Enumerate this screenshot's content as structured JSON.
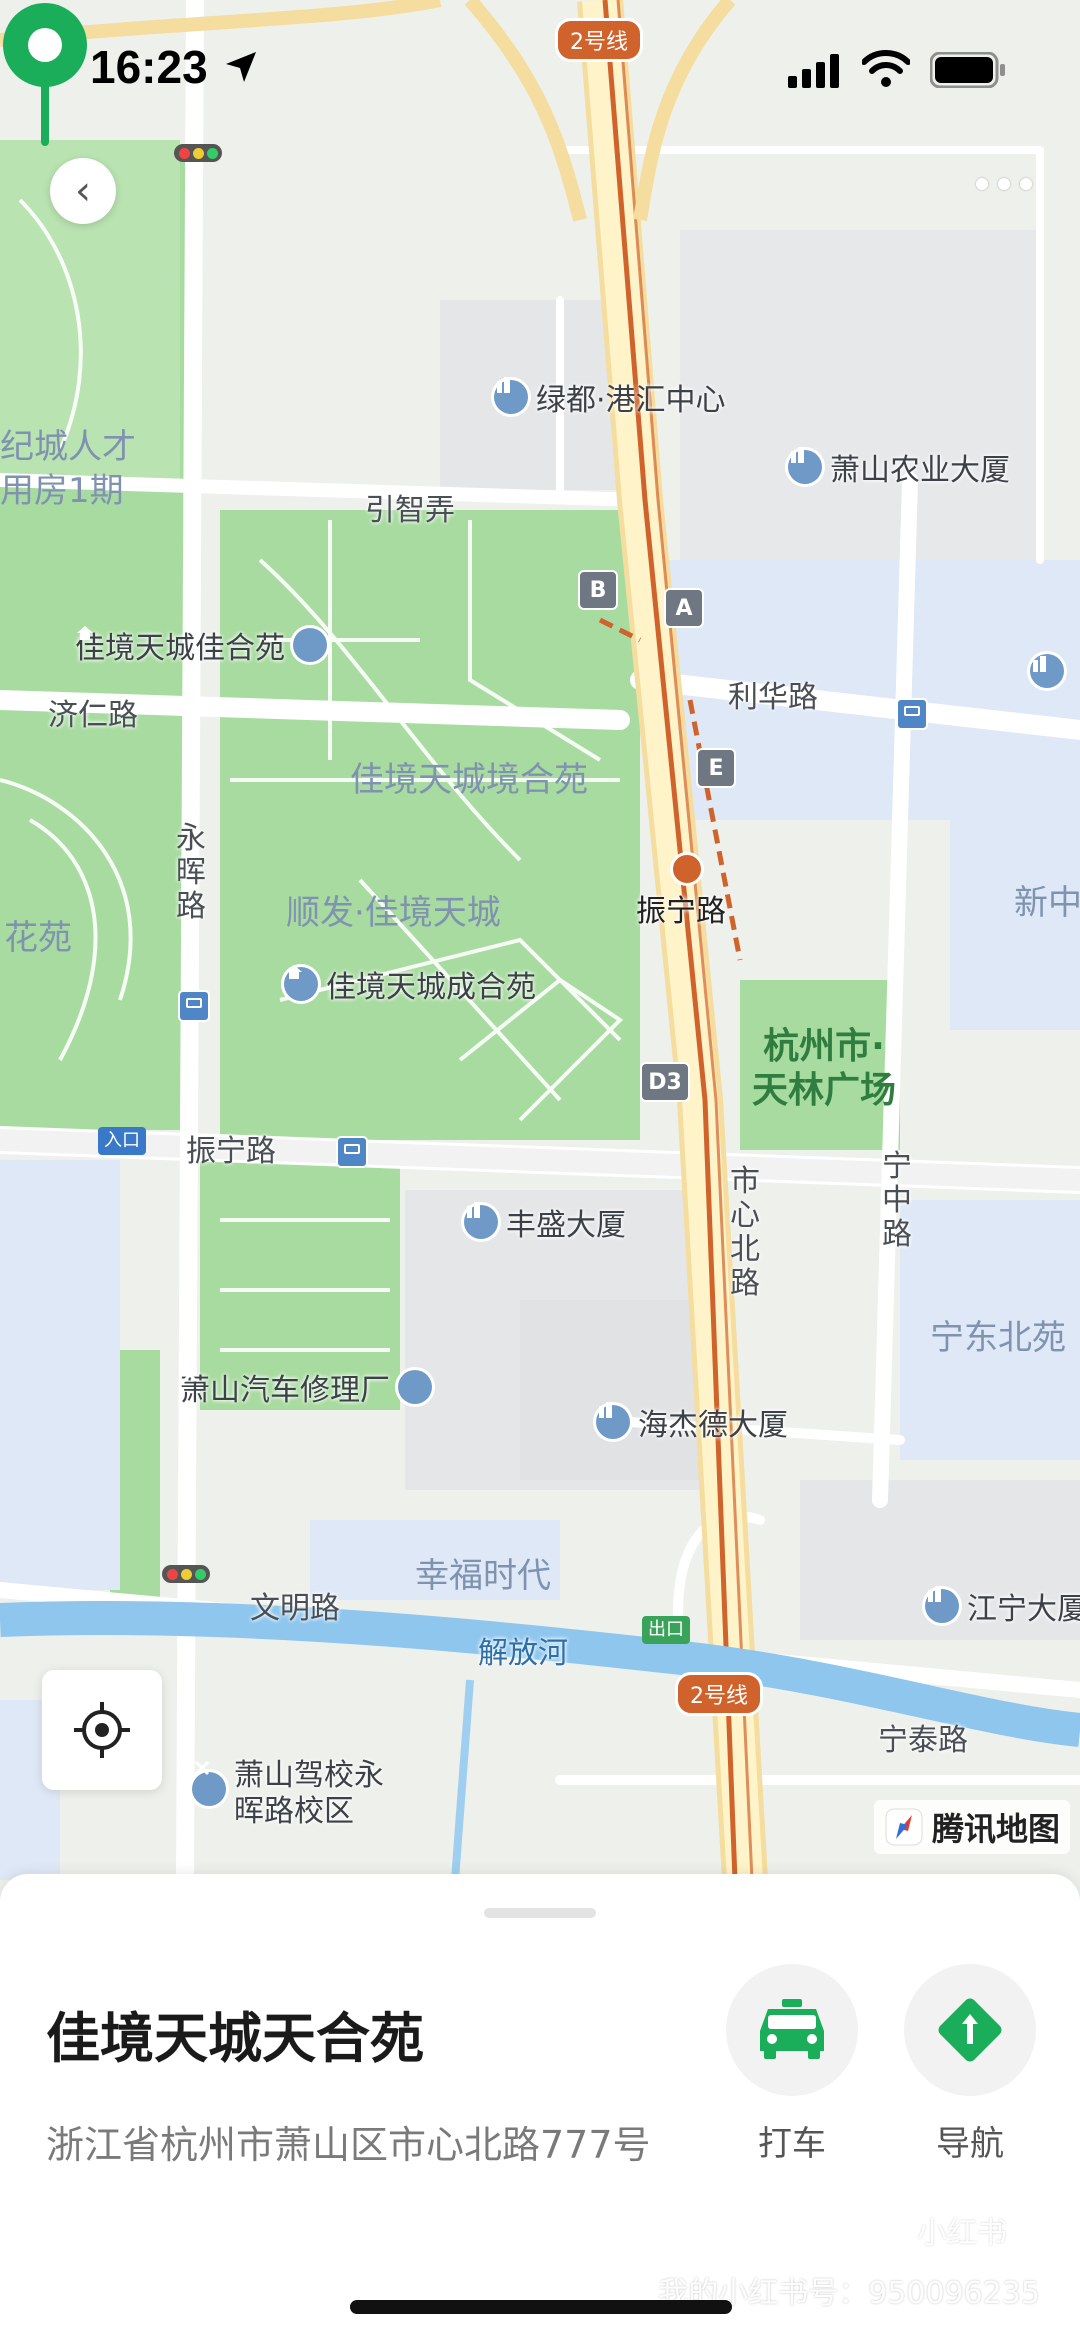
{
  "status_bar": {
    "time": "16:23",
    "icons": [
      "location-arrow-icon",
      "cellular-signal-icon",
      "wifi-icon",
      "battery-icon"
    ]
  },
  "map": {
    "metro_line_badge": "2号线",
    "roads": {
      "yinzhi": "引智弄",
      "jiren": "济仁路",
      "yonghui": [
        "永",
        "晖",
        "路"
      ],
      "lihua": "利华路",
      "zhenning_west": "振宁路",
      "shixin_north": [
        "市",
        "心",
        "北",
        "路"
      ],
      "ningzhong": [
        "宁",
        "中",
        "路"
      ],
      "wenming": "文明路",
      "ningtai": "宁泰路",
      "river": "解放河"
    },
    "areas": {
      "jingheyuan": "佳境天城境合苑",
      "shunfa": "顺发·佳境天城",
      "jicheng": [
        "纪城人才",
        "用房1期"
      ],
      "huayuan": "花苑",
      "xinzhong": "新中",
      "ningdong": "宁东北苑",
      "xingfu": "幸福时代",
      "park": [
        "杭州市·",
        "天林广场"
      ]
    },
    "pois": {
      "lvdu": "绿都·港汇中心",
      "nongye": "萧山农业大厦",
      "jiahe": "佳境天城佳合苑",
      "chenghe": "佳境天城成合苑",
      "fengsheng": "丰盛大厦",
      "qixiu": "萧山汽车修理厂",
      "haijiede": "海杰德大厦",
      "jiangning": "江宁大厦",
      "jiaxiao": [
        "萧山驾校永",
        "晖路校区"
      ]
    },
    "metro_station": "振宁路",
    "exits": {
      "a": "A",
      "b": "B",
      "e": "E",
      "d3": "D3"
    },
    "gates": {
      "entry": "入口",
      "exit": "出口"
    },
    "logo": "腾讯地图"
  },
  "sheet": {
    "title": "佳境天城天合苑",
    "address": "浙江省杭州市萧山区市心北路777号",
    "actions": {
      "taxi": "打车",
      "navigate": "导航"
    }
  },
  "watermark": {
    "id": "我的小红书号：950096235",
    "logo": "小红书"
  },
  "colors": {
    "green_accent": "#1aad5a",
    "metro_line": "#d0632c",
    "park_green": "#a8dba0",
    "residential_blue": "#dfe8f6"
  }
}
